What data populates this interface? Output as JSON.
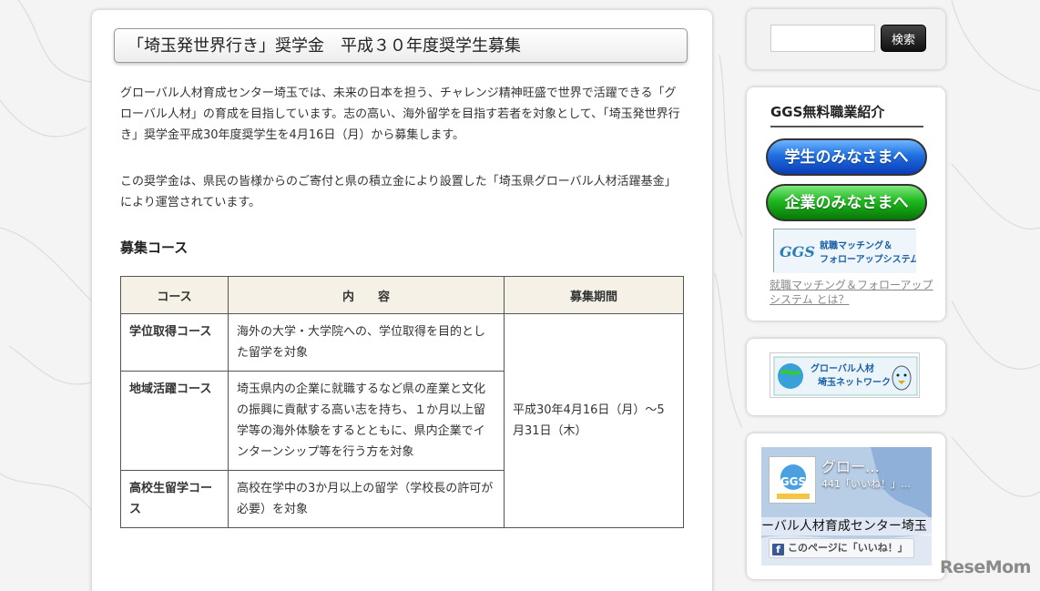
{
  "article": {
    "title": "「埼玉発世界行き」奨学金　平成３０年度奨学生募集",
    "paragraph1": "グローバル人材育成センター埼玉では、未来の日本を担う、チャレンジ精神旺盛で世界で活躍できる「グローバル人材」の育成を目指しています。志の高い、海外留学を目指す若者を対象として、「埼玉発世界行き」奨学金平成30年度奨学生を4月16日（月）から募集します。",
    "paragraph2": "この奨学金は、県民の皆様からのご寄付と県の積立金により設置した「埼玉県グローバル人材活躍基金」により運営されています。",
    "section_heading": "募集コース",
    "table": {
      "headers": [
        "コース",
        "内　　容",
        "募集期間"
      ],
      "rows": [
        {
          "course": "学位取得コース",
          "content": "海外の大学・大学院への、学位取得を目的とした留学を対象"
        },
        {
          "course": "地域活躍コース",
          "content": "埼玉県内の企業に就職するなど県の産業と文化の振興に貢献する高い志を持ち、１か月以上留学等の海外体験をするとともに、県内企業でインターンシップ等を行う方を対象"
        },
        {
          "course": "高校生留学コース",
          "content": "高校在学中の3か月以上の留学（学校長の許可が必要）を対象"
        }
      ],
      "period": "平成30年4月16日（月）～5月31日（木）"
    }
  },
  "sidebar": {
    "search": {
      "value": "",
      "button_label": "検索"
    },
    "ggs": {
      "title": "GGS無料職業紹介",
      "students_button": "学生のみなさまへ",
      "companies_button": "企業のみなさまへ",
      "banner_line1": "就職マッチング＆",
      "banner_line2": "フォローアップシステム",
      "banner_logo": "GGS",
      "link": "就職マッチング＆フォローアップシステム とは？"
    },
    "network_banner": {
      "line1": "グローバル人材",
      "line2": "埼玉ネットワーク"
    },
    "facebook": {
      "page_name": "グロー…",
      "likes": "441「いいね！」…",
      "cover_text": "ーバル人材育成センター埼玉",
      "logo_text": "GGS",
      "like_button": "このページに「いいね！」",
      "f_glyph": "f"
    }
  },
  "watermark": "ReseMom",
  "colors": {
    "table_header_bg": "#f5f1e6",
    "blue_button": "#1f6fe0",
    "green_button": "#1fb81f",
    "search_button": "#222222",
    "facebook_blue": "#3b5998"
  }
}
